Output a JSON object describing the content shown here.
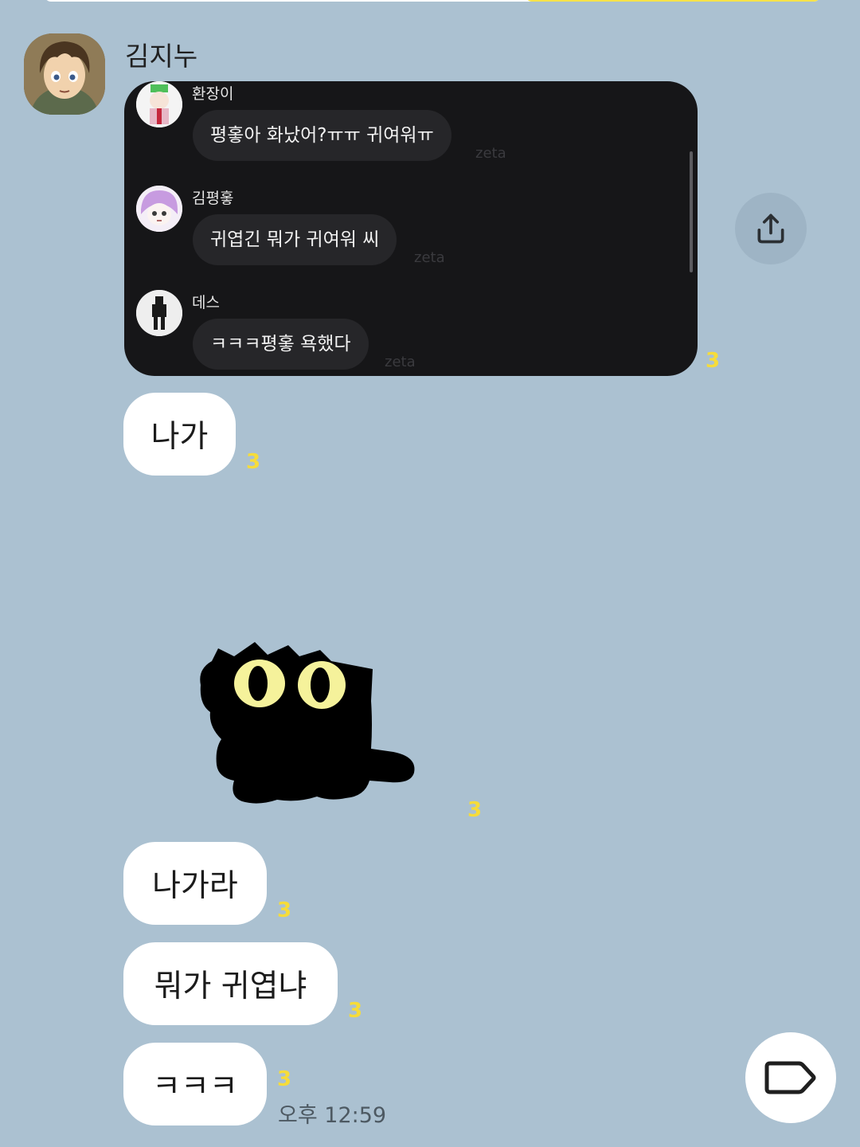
{
  "message": {
    "sender": "김지누",
    "unread_counts": [
      "3",
      "3",
      "3",
      "3",
      "3",
      "3"
    ],
    "timestamp": "오후 12:59"
  },
  "shared_screenshot": {
    "entries": [
      {
        "name": "환장이",
        "text": "평홓아 화났어?ㅠㅠ 귀여워ㅠ",
        "meta": "zeta"
      },
      {
        "name": "김평홓",
        "text": "귀엽긴 뭐가 귀여워 씨",
        "meta": "zeta"
      },
      {
        "name": "데스",
        "text": "ㅋㅋㅋ평홓 욕했다",
        "meta": "zeta"
      }
    ]
  },
  "bubbles": [
    "나가",
    "나가라",
    "뭐가 귀엽냐",
    "ㅋㅋㅋ"
  ],
  "icons": {
    "share": "share-icon",
    "tag": "tag-icon",
    "sticker": "black-cat-sticker"
  },
  "colors": {
    "background": "#abc1d1",
    "bubble": "#ffffff",
    "unread": "#f6dc3a",
    "dark_panel": "#161618"
  }
}
